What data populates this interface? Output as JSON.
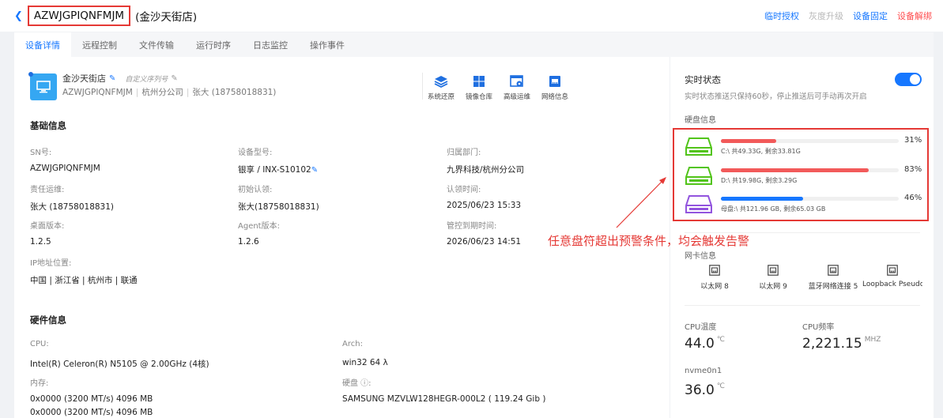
{
  "header": {
    "device_id": "AZWJGPIQNFMJM",
    "device_name": "(金沙天街店)",
    "actions": {
      "temp_auth": "临时授权",
      "gray_upgrade": "灰度升级",
      "fix_device": "设备固定",
      "unbind": "设备解绑"
    }
  },
  "tabs": [
    "设备详情",
    "远程控制",
    "文件传输",
    "运行时序",
    "日志监控",
    "操作事件"
  ],
  "device_card": {
    "name": "金沙天街店",
    "serial_placeholder": "自定义序列号",
    "code": "AZWJGPIQNFMJM",
    "branch": "杭州分公司",
    "owner": "张大 (18758018831)"
  },
  "quick_actions": [
    {
      "label": "系统还原",
      "icon": "layers-icon"
    },
    {
      "label": "镜像仓库",
      "icon": "windows-icon"
    },
    {
      "label": "高级运维",
      "icon": "gear-window-icon"
    },
    {
      "label": "网络信息",
      "icon": "network-icon"
    }
  ],
  "basic_info": {
    "title": "基础信息",
    "fields": [
      {
        "label": "SN号:",
        "value": "AZWJGPIQNFMJM"
      },
      {
        "label": "设备型号:",
        "value": "银享  / INX-S10102"
      },
      {
        "label": "归属部门:",
        "value": "九界科技/杭州分公司"
      },
      {
        "label": "责任运维:",
        "value": "张大 (18758018831)"
      },
      {
        "label": "初始认领:",
        "value": "张大(18758018831)"
      },
      {
        "label": "认领时间:",
        "value": "2025/06/23 15:33"
      },
      {
        "label": "桌面版本:",
        "value": "1.2.5"
      },
      {
        "label": "Agent版本:",
        "value": "1.2.6"
      },
      {
        "label": "管控到期时间:",
        "value": "2026/06/23 14:51"
      },
      {
        "label": "IP地址位置:",
        "value": "中国 | 浙江省 | 杭州市 | 联通"
      }
    ]
  },
  "hardware_info": {
    "title": "硬件信息",
    "cpu_label": "CPU:",
    "cpu_value": "Intel(R) Celeron(R) N5105 @ 2.00GHz (4核)",
    "arch_label": "Arch:",
    "arch_value": "win32 64 λ",
    "mem_label": "内存:",
    "mem_values": [
      "0x0000 (3200 MT/s) 4096 MB",
      "0x0000 (3200 MT/s) 4096 MB"
    ],
    "disk_label": "硬盘 ⓘ:",
    "disk_value": "SAMSUNG MZVLW128HEGR-000L2 ( 119.24 Gib )"
  },
  "realtime": {
    "title": "实时状态",
    "desc": "实时状态推送只保持60秒，停止推送后可手动再次开启",
    "enabled": true,
    "disk_title": "硬盘信息",
    "disks": [
      {
        "info": "C:\\ 共49.33G, 剩余33.81G",
        "percent": 31,
        "pct_text": "31%",
        "color": "#f25a5a",
        "icon_color": "#52c41a"
      },
      {
        "info": "D:\\ 共19.98G, 剩余3.29G",
        "percent": 83,
        "pct_text": "83%",
        "color": "#f25a5a",
        "icon_color": "#52c41a"
      },
      {
        "info": "母盘:\\ 共121.96 GB, 剩余65.03 GB",
        "percent": 46,
        "pct_text": "46%",
        "color": "#1677ff",
        "icon_color": "#9254de"
      }
    ],
    "nic_title": "网卡信息",
    "nics": [
      "以太网 8",
      "以太网 9",
      "蓝牙网络连接 5",
      "Loopback Pseudo"
    ],
    "cpu_temp_label": "CPU温度",
    "cpu_temp_value": "44.0",
    "cpu_temp_unit": "℃",
    "cpu_freq_label": "CPU频率",
    "cpu_freq_value": "2,221.15",
    "cpu_freq_unit": "MHZ",
    "nvme_label": "nvme0n1",
    "nvme_value": "36.0",
    "nvme_unit": "℃"
  },
  "annotation": "任意盘符超出预警条件，均会触发告警"
}
